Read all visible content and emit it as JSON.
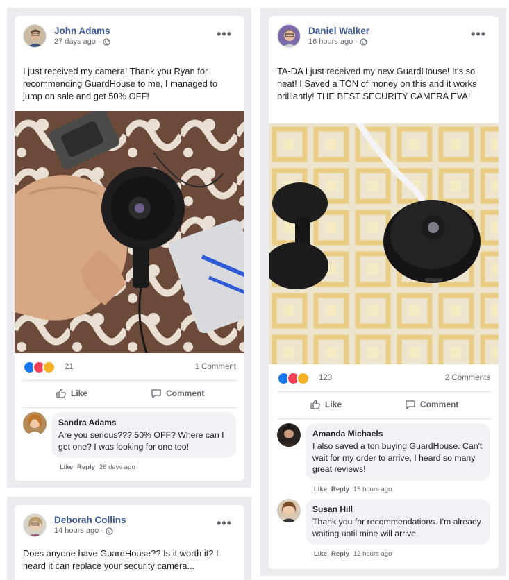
{
  "posts": [
    {
      "author": "John Adams",
      "time": "27 days ago · ",
      "more": "•••",
      "text": "I just received my camera! Thank you Ryan for recommending GuardHouse to me, I managed to jump on sale and get 50% OFF!",
      "reaction_count": "21",
      "comment_count": "1 Comment",
      "actions": {
        "like": "Like",
        "comment": "Comment"
      },
      "comments": [
        {
          "name": "Sandra Adams",
          "text": "Are you serious??? 50% OFF? Where can I get one? I was looking for one too!",
          "like": "Like",
          "reply": "Reply",
          "time": "26 days ago"
        }
      ]
    },
    {
      "author": "Daniel Walker",
      "time": "16 hours ago · ",
      "more": "•••",
      "text": "TA-DA I just received my new GuardHouse! It's so neat! I Saved a TON of money on this and it works brilliantly! THE BEST SECURITY CAMERA EVA!",
      "reaction_count": "123",
      "comment_count": "2 Comments",
      "actions": {
        "like": "Like",
        "comment": "Comment"
      },
      "comments": [
        {
          "name": "Amanda Michaels",
          "text": "I also saved a ton buying GuardHouse. Can't wait for my order to arrive, I heard so many great reviews!",
          "like": "Like",
          "reply": "Reply",
          "time": "15 hours ago"
        },
        {
          "name": "Susan Hill",
          "text": "Thank you for recommendations. I'm already waiting until mine will arrive.",
          "like": "Like",
          "reply": "Reply",
          "time": "12 hours ago"
        }
      ]
    },
    {
      "author": "Deborah Collins",
      "time": "14 hours ago · ",
      "more": "•••",
      "text": "Does anyone have GuardHouse?? Is it worth it? I heard it can replace your security camera..."
    }
  ],
  "icons": {
    "globe": "globe-icon",
    "like": "thumbs-up-icon",
    "comment": "speech-bubble-icon",
    "reactions": [
      "like-reaction-icon",
      "love-reaction-icon",
      "haha-reaction-icon"
    ]
  },
  "colors": {
    "author": "#385898",
    "background": "#e9ebee",
    "bubble": "#f0f2f5",
    "like_reaction": "#1877f2",
    "love_reaction": "#f33e58",
    "haha_reaction": "#f7b125"
  }
}
